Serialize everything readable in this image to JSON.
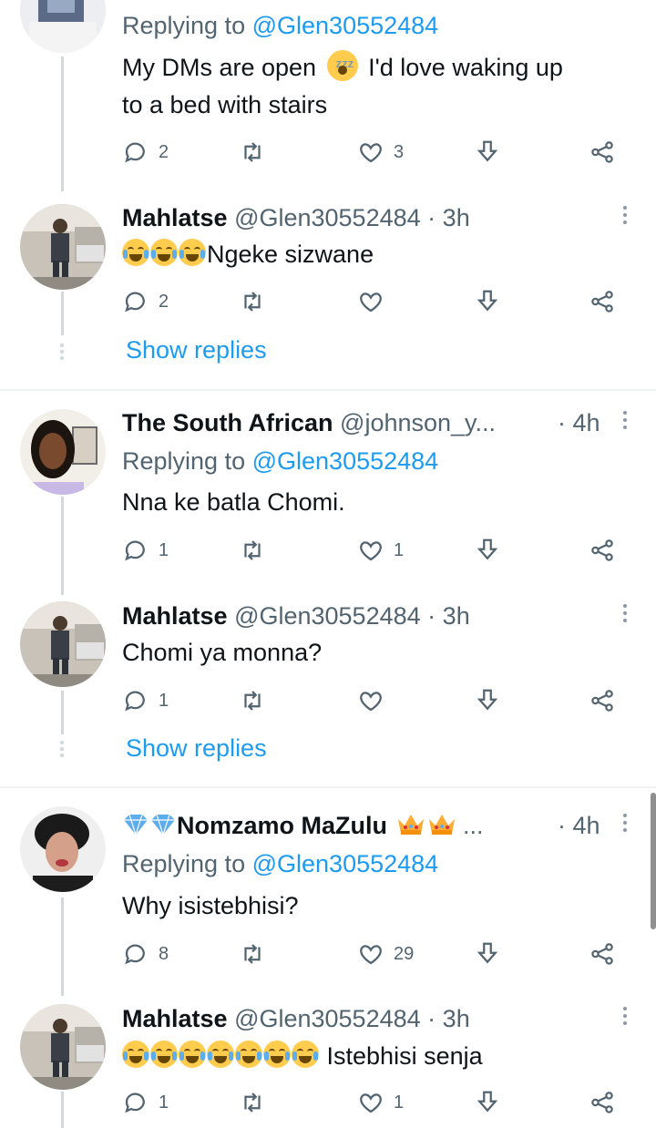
{
  "colors": {
    "accent": "#1d9bf0",
    "muted": "#536471",
    "line": "#cfd9de"
  },
  "tweets": [
    {
      "replying_prefix": "Replying to",
      "replying_handle": "@Glen30552484",
      "text_before": "My DMs are open",
      "emoji": "sleeping-face",
      "text_after": "I'd love waking up",
      "text_line2": "to a bed with stairs",
      "replies": "2",
      "likes": "3"
    },
    {
      "name": "Mahlatse",
      "handle": "@Glen30552484",
      "sep": "·",
      "time": "3h",
      "text": "Ngeke sizwane",
      "replies": "2",
      "likes": ""
    },
    {
      "name": "The South African",
      "handle": "@johnson_y...",
      "sep": "·",
      "time": "4h",
      "replying_prefix": "Replying to",
      "replying_handle": "@Glen30552484",
      "text": "Nna ke batla Chomi.",
      "replies": "1",
      "likes": "1"
    },
    {
      "name": "Mahlatse",
      "handle": "@Glen30552484",
      "sep": "·",
      "time": "3h",
      "text": "Chomi ya monna?",
      "replies": "1",
      "likes": ""
    },
    {
      "name": "Nomzamo MaZulu",
      "handle": "...",
      "sep": "·",
      "time": "4h",
      "replying_prefix": "Replying to",
      "replying_handle": "@Glen30552484",
      "text": "Why isistebhisi?",
      "replies": "8",
      "likes": "29"
    },
    {
      "name": "Mahlatse",
      "handle": "@Glen30552484",
      "sep": "·",
      "time": "3h",
      "text": "Istebhisi senja",
      "replies": "1",
      "likes": "1"
    }
  ],
  "show_replies": "Show replies",
  "icons": [
    "reply-icon",
    "retweet-icon",
    "like-icon",
    "download-icon",
    "share-icon",
    "more-icon"
  ]
}
